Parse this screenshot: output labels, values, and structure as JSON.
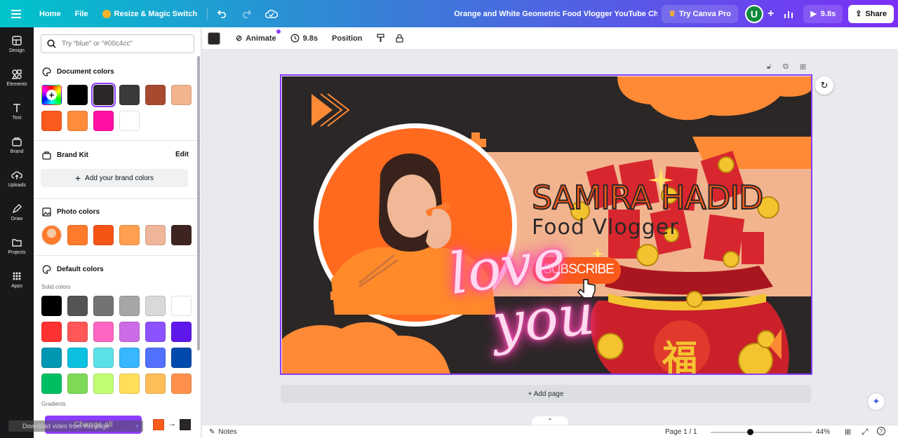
{
  "topbar": {
    "home_label": "Home",
    "file_label": "File",
    "resize_label": "Resize & Magic Switch",
    "doc_title": "Orange and White Geometric Food Vlogger YouTube Chann...",
    "try_pro_label": "Try Canva Pro",
    "avatar_letter": "U",
    "play_duration": "9.8s",
    "share_label": "Share"
  },
  "rail": {
    "items": [
      {
        "label": "Design",
        "icon": "design-icon"
      },
      {
        "label": "Elements",
        "icon": "elements-icon"
      },
      {
        "label": "Text",
        "icon": "text-icon"
      },
      {
        "label": "Brand",
        "icon": "brand-icon"
      },
      {
        "label": "Uploads",
        "icon": "uploads-icon"
      },
      {
        "label": "Draw",
        "icon": "draw-icon"
      },
      {
        "label": "Projects",
        "icon": "projects-icon"
      },
      {
        "label": "Apps",
        "icon": "apps-icon"
      }
    ]
  },
  "panel": {
    "search_placeholder": "Try “blue” or “#00c4cc”",
    "document_colors_title": "Document colors",
    "document_colors": [
      "#000000",
      "#2b2727",
      "#3a3a3a",
      "#a84a30",
      "#f2b48e",
      "#fa5a1c",
      "#ff8c3b",
      "#ff0fa3",
      "#ffffff"
    ],
    "brand_kit_title": "Brand Kit",
    "brand_kit_edit": "Edit",
    "brand_add_label": "Add your brand colors",
    "photo_colors_title": "Photo colors",
    "photo_colors": [
      "#ff7a2a",
      "#f65415",
      "#ff9f4f",
      "#efb69a",
      "#3e2420"
    ],
    "default_colors_title": "Default colors",
    "solid_colors_label": "Solid colors",
    "solid_colors": [
      "#000000",
      "#545454",
      "#737373",
      "#a6a6a6",
      "#d9d9d9",
      "#ffffff",
      "#ff3131",
      "#ff5757",
      "#ff66c4",
      "#cb6ce6",
      "#8c52ff",
      "#5e17eb",
      "#0097b2",
      "#0cc0df",
      "#5ce1e6",
      "#38b6ff",
      "#5271ff",
      "#004aad",
      "#00bf63",
      "#7ed957",
      "#c1ff72",
      "#ffde59",
      "#ffbd59",
      "#ff914d"
    ],
    "gradients_label": "Gradients",
    "change_all_label": "Change all",
    "change_from": "#fa5a1c",
    "change_to": "#2b2727",
    "download_overlay": "Download video from this page"
  },
  "editor_toolbar": {
    "animate_label": "Animate",
    "duration_label": "9.8s",
    "position_label": "Position"
  },
  "design": {
    "name": "SAMIRA HADID",
    "subtitle": "Food Vlogger",
    "subscribe": "SUBSCRIBE",
    "neon_line1": "love",
    "neon_line2": "you",
    "fu_char": "福",
    "colors": {
      "dark": "#2b2727",
      "orange": "#ff8a35",
      "peach": "#f2b48e",
      "red": "#c9202a",
      "gold": "#f4c430",
      "neon": "#ff4fb8"
    }
  },
  "add_page_label": "+ Add page",
  "footer": {
    "notes_label": "Notes",
    "page_indicator": "Page 1 / 1",
    "zoom_label": "44%",
    "zoom_level": 0.44
  }
}
